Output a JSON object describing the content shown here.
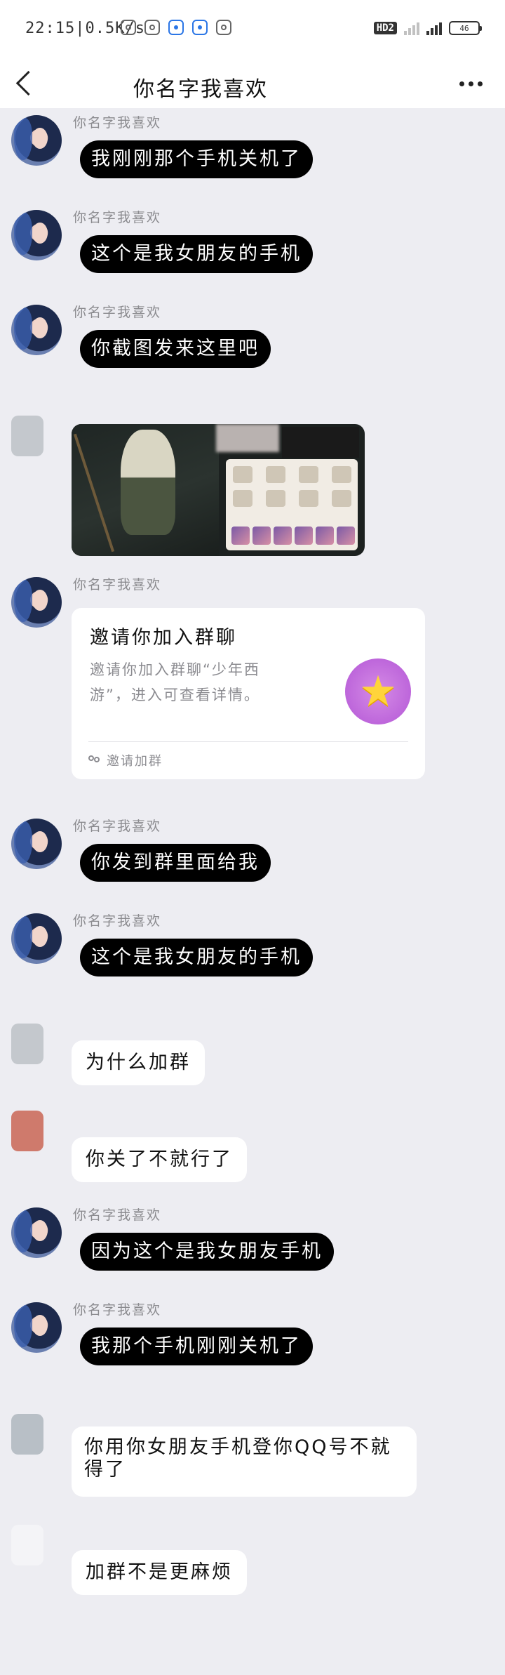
{
  "status_bar": {
    "time": "22:15|0.5K/s",
    "hd": "HD2",
    "battery": "46"
  },
  "header": {
    "title": "你名字我喜欢"
  },
  "messages": [
    {
      "sender": "你名字我喜欢",
      "text": "我刚刚那个手机关机了"
    },
    {
      "sender": "你名字我喜欢",
      "text": "这个是我女朋友的手机"
    },
    {
      "sender": "你名字我喜欢",
      "text": "你截图发来这里吧"
    },
    {
      "sender": "你名字我喜欢",
      "invite_title": "邀请你加入群聊",
      "invite_desc": "邀请你加入群聊“少年西游”，进入可查看详情。",
      "invite_footer": "邀请加群"
    },
    {
      "sender": "你名字我喜欢",
      "text": "你发到群里面给我"
    },
    {
      "sender": "你名字我喜欢",
      "text": "这个是我女朋友的手机"
    },
    {
      "text": "为什么加群"
    },
    {
      "text": "你关了不就行了"
    },
    {
      "sender": "你名字我喜欢",
      "text": "因为这个是我女朋友手机"
    },
    {
      "sender": "你名字我喜欢",
      "text": "我那个手机刚刚关机了"
    },
    {
      "text": "你用你女朋友手机登你QQ号不就得了"
    },
    {
      "text": "加群不是更麻烦"
    }
  ]
}
